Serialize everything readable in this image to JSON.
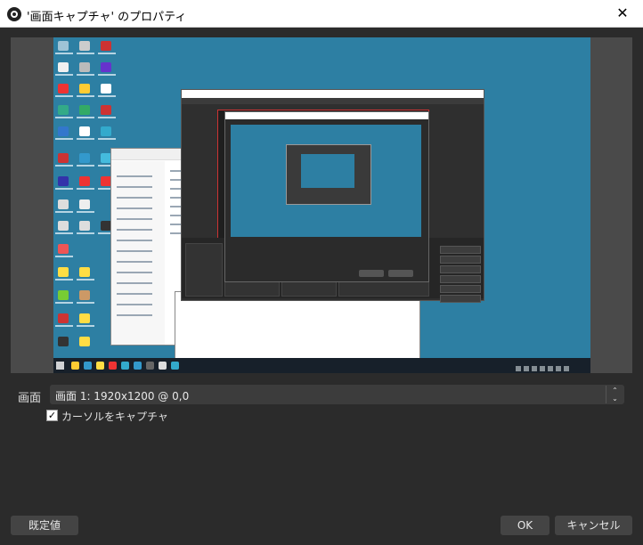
{
  "window": {
    "title": "'画面キャプチャ' のプロパティ",
    "close_glyph": "✕",
    "app_icon": "obs-logo-icon"
  },
  "preview": {
    "description_icon": "display-capture-preview",
    "background_color": "#2d7fa3"
  },
  "properties": {
    "screen_label": "画面",
    "screen_value": "画面 1: 1920x1200 @ 0,0",
    "spin_up": "⌃",
    "spin_down": "⌄",
    "cursor_checkbox": {
      "label": "カーソルをキャプチャ",
      "checked": true,
      "check_glyph": "✓"
    }
  },
  "buttons": {
    "defaults": "既定値",
    "ok": "OK",
    "cancel": "キャンセル"
  },
  "colors": {
    "dialog_bg": "#2b2b2b",
    "control_bg": "#3c3c3c",
    "button_bg": "#444444",
    "accent_red": "#cc3333"
  }
}
